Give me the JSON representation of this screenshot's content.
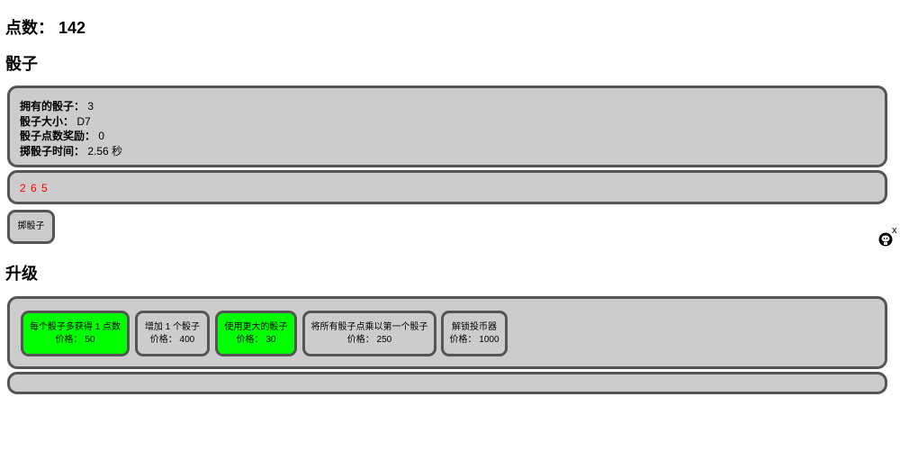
{
  "points": {
    "label": "点数：",
    "value": "142"
  },
  "dice_heading": "骰子",
  "stats": [
    {
      "label": "拥有的骰子：",
      "value": "3"
    },
    {
      "label": "骰子大小：",
      "value": "D7"
    },
    {
      "label": "骰子点数奖励：",
      "value": "0"
    },
    {
      "label": "掷骰子时间：",
      "value": "2.56 秒"
    }
  ],
  "rolls": "2 6 5",
  "roll_button": "掷骰子",
  "upgrades_heading": "升级",
  "upgrades": [
    {
      "name": "每个骰子多获得 1 点数",
      "price": "价格： 50",
      "affordable": true
    },
    {
      "name": "增加 1 个骰子",
      "price": "价格： 400",
      "affordable": false
    },
    {
      "name": "使用更大的骰子",
      "price": "价格： 30",
      "affordable": true
    },
    {
      "name": "将所有骰子点乘以第一个骰子",
      "price": "价格： 250",
      "affordable": false
    },
    {
      "name": "解锁投币器",
      "price": "价格： 1000",
      "affordable": false
    }
  ],
  "colors": {
    "panel": "#cccccc",
    "border": "#555555",
    "affordable": "#00ff00",
    "roll_text": "#ff0000"
  },
  "corner_icon": {
    "name": "github-octocat-icon",
    "close": "x"
  }
}
